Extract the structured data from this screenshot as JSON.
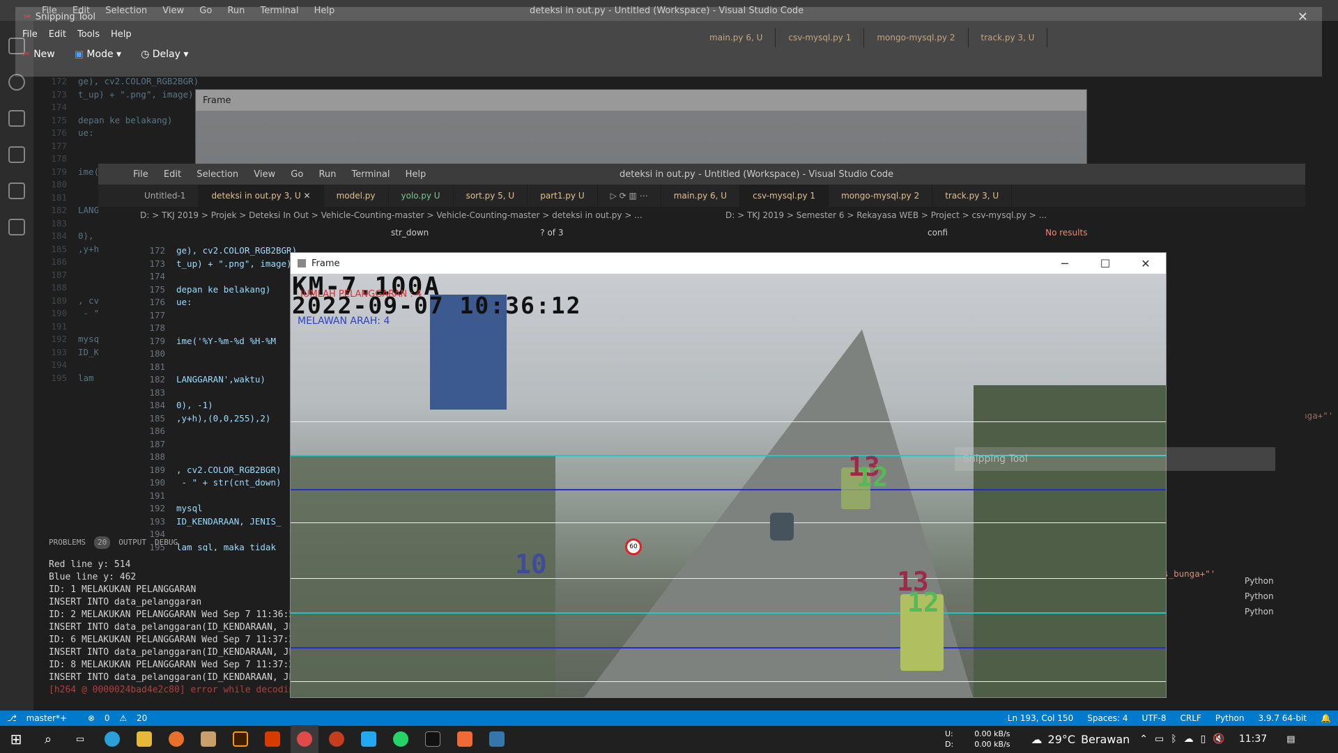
{
  "snip": {
    "title": "Snipping Tool",
    "menu": [
      "File",
      "Edit",
      "Tools",
      "Help"
    ],
    "new": "New",
    "mode": "Mode",
    "delay": "Delay"
  },
  "vsc_menu": [
    "File",
    "Edit",
    "Selection",
    "View",
    "Go",
    "Run",
    "Terminal",
    "Help"
  ],
  "vsc_title": "deteksi in out.py - Untitled (Workspace) - Visual Studio Code",
  "tabs_left": [
    {
      "label": "Untitled-1",
      "flag": ""
    },
    {
      "label": "deteksi in out.py",
      "flag": "3, U",
      "active": true
    },
    {
      "label": "model.py",
      "flag": ""
    },
    {
      "label": "yolo.py",
      "flag": "U"
    },
    {
      "label": "sort.py",
      "flag": "5, U"
    },
    {
      "label": "part1.py",
      "flag": "U"
    }
  ],
  "tabs_right": [
    {
      "label": "main.py",
      "flag": "6, U"
    },
    {
      "label": "csv-mysql.py",
      "flag": "1"
    },
    {
      "label": "mongo-mysql.py",
      "flag": "2"
    },
    {
      "label": "track.py",
      "flag": "3, U"
    }
  ],
  "bread_left": "D: > TKJ 2019 > Projek > Deteksi In Out > Vehicle-Counting-master > Vehicle-Counting-master > deteksi in out.py > ...",
  "bread_right": "D: > TKJ 2019 > Semester 6 > Rekayasa WEB > Project > csv-mysql.py > ...",
  "find_left": {
    "query": "str_down",
    "count": "? of 3"
  },
  "find_right": {
    "query": "confi",
    "count": "No results"
  },
  "code_lines": [
    {
      "n": "172",
      "t": "ge), cv2.COLOR_RGB2BGR)"
    },
    {
      "n": "173",
      "t": "t_up) + \".png\", image)"
    },
    {
      "n": "174",
      "t": ""
    },
    {
      "n": "175",
      "t": "depan ke belakang)"
    },
    {
      "n": "176",
      "t": "ue:"
    },
    {
      "n": "177",
      "t": ""
    },
    {
      "n": "178",
      "t": ""
    },
    {
      "n": "179",
      "t": "ime('%Y-%m-%d %H-%M"
    },
    {
      "n": "180",
      "t": ""
    },
    {
      "n": "181",
      "t": ""
    },
    {
      "n": "182",
      "t": "LANGGARAN',waktu)"
    },
    {
      "n": "183",
      "t": ""
    },
    {
      "n": "184",
      "t": "0), -1)"
    },
    {
      "n": "185",
      "t": ",y+h),(0,0,255),2)"
    },
    {
      "n": "186",
      "t": ""
    },
    {
      "n": "187",
      "t": ""
    },
    {
      "n": "188",
      "t": ""
    },
    {
      "n": "189",
      "t": ", cv2.COLOR_RGB2BGR)"
    },
    {
      "n": "190",
      "t": " - \" + str(cnt_down)"
    },
    {
      "n": "191",
      "t": ""
    },
    {
      "n": "192",
      "t": "mysql"
    },
    {
      "n": "193",
      "t": "ID_KENDARAAN, JENIS_"
    },
    {
      "n": "194",
      "t": ""
    },
    {
      "n": "195",
      "t": "lam sql, maka tidak"
    }
  ],
  "panel": {
    "tabs": [
      "PROBLEMS",
      "OUTPUT",
      "DEBUG"
    ],
    "badge": "20"
  },
  "terminal": [
    "Red line y: 514",
    "Blue line y: 462",
    "ID: 1 MELAKUKAN PELANGGARAN",
    "INSERT INTO data_pelanggaran",
    "ID: 2 MELAKUKAN PELANGGARAN Wed Sep  7 11:36:58 2022",
    "INSERT INTO data_pelanggaran(ID_KENDARAAN, JENIS_PELANGGARAN, WAKTU) VALUES ('2', 'Melawan Arus', curdate())",
    "ID: 6 MELAKUKAN PELANGGARAN Wed Sep  7 11:37:23 2022",
    "INSERT INTO data_pelanggaran(ID_KENDARAAN, JENIS_PELANGGARAN, WAKTU) VALUES ('6', 'Melawan Arus', curdate())",
    "ID: 8 MELAKUKAN PELANGGARAN Wed Sep  7 11:37:24 2022",
    "INSERT INTO data_pelanggaran(ID_KENDARAAN, JENIS_PELANGGARAN, WAKTU) VALUES ('8', 'Melawan Arus', curdate())",
    "[h264 @ 0000024bad4e2c80] error while decoding MB 52 26, bytestream -8"
  ],
  "right_code": [
    "par_bunga+\"', '\"+jenis_bunga+\"'",
    "par_bunga+\"', '\"+jenis_bunga+\"'"
  ],
  "right_panel": [
    "Python",
    "Python",
    "Python"
  ],
  "frame": {
    "title": "Frame",
    "km": "KM-7.100A",
    "jumlah": "JUMLAH PELANGGARAN : 4",
    "datetime": "2022-09-07 10:36:12",
    "melawan": "MELAWAN ARAH: 4",
    "ids": [
      "13",
      "12",
      "10",
      "13",
      "12"
    ],
    "speed1": "60",
    "speed2": "60"
  },
  "snip_ghost": "Snipping Tool",
  "status": {
    "branch": "master*+",
    "errors": "0",
    "warnings": "20",
    "pos": "Ln 193, Col 150",
    "spaces": "Spaces: 4",
    "enc": "UTF-8",
    "eol": "CRLF",
    "lang": "Python",
    "ver": "3.9.7 64-bit"
  },
  "taskbar": {
    "net_up": "U:",
    "net_down": "D:",
    "up_speed": "0.00 kB/s",
    "down_speed": "0.00 kB/s",
    "temp": "29°C",
    "weather": "Berawan",
    "time": "11:37"
  },
  "colors": {
    "accent": "#007acc",
    "red_line": "#e03030",
    "blue_line": "#1e2fd8",
    "cyan_line": "#20c8c0"
  }
}
